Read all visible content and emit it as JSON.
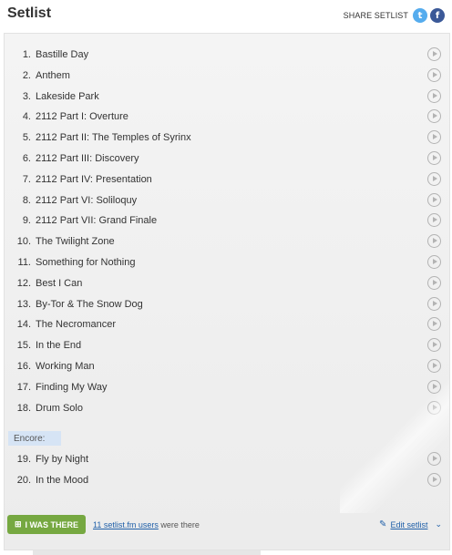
{
  "header": {
    "title": "Setlist",
    "share_label": "SHARE SETLIST",
    "twitter_glyph": "t",
    "facebook_glyph": "f"
  },
  "songs": [
    {
      "num": "1.",
      "title": "Bastille Day"
    },
    {
      "num": "2.",
      "title": "Anthem"
    },
    {
      "num": "3.",
      "title": "Lakeside Park"
    },
    {
      "num": "4.",
      "title": "2112 Part I: Overture"
    },
    {
      "num": "5.",
      "title": "2112 Part II: The Temples of Syrinx"
    },
    {
      "num": "6.",
      "title": "2112 Part III: Discovery"
    },
    {
      "num": "7.",
      "title": "2112 Part IV: Presentation"
    },
    {
      "num": "8.",
      "title": "2112 Part VI: Soliloquy"
    },
    {
      "num": "9.",
      "title": "2112 Part VII: Grand Finale"
    },
    {
      "num": "10.",
      "title": "The Twilight Zone"
    },
    {
      "num": "11.",
      "title": "Something for Nothing"
    },
    {
      "num": "12.",
      "title": "Best I Can"
    },
    {
      "num": "13.",
      "title": "By-Tor & The Snow Dog"
    },
    {
      "num": "14.",
      "title": "The Necromancer"
    },
    {
      "num": "15.",
      "title": "In the End"
    },
    {
      "num": "16.",
      "title": "Working Man"
    },
    {
      "num": "17.",
      "title": "Finding My Way"
    },
    {
      "num": "18.",
      "title": "Drum Solo"
    }
  ],
  "encore": {
    "label": "Encore:",
    "songs": [
      {
        "num": "19.",
        "title": "Fly by Night"
      },
      {
        "num": "20.",
        "title": "In the Mood"
      }
    ]
  },
  "footer": {
    "i_was_there": "I WAS THERE",
    "users_link": "11 setlist.fm users",
    "users_suffix": " were there",
    "edit_label": "Edit setlist"
  },
  "icons": {
    "twitter": "twitter-icon",
    "facebook": "facebook-icon",
    "play": "play-icon",
    "pencil": "pencil-icon",
    "chevron": "chevron-down-icon",
    "check": "check-icon"
  },
  "colors": {
    "twitter": "#55acee",
    "facebook": "#3b5998",
    "button_green": "#76a841",
    "link_blue": "#1f5fa8",
    "encore_bg": "#d6e4f5"
  }
}
